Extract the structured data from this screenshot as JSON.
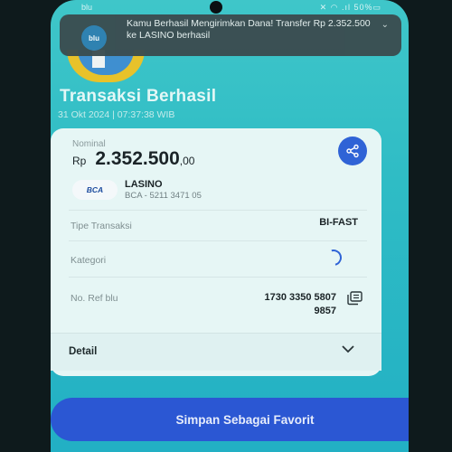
{
  "statusbar": {
    "carrier": "blu",
    "icons": "✕ ◠ .ıl 50%▭"
  },
  "notification": {
    "app_logo": "blu",
    "text": "Kamu Berhasil Mengirimkan Dana! Transfer Rp 2.352.500 ke LASINO berhasil"
  },
  "header": {
    "title": "Transaksi Berhasil",
    "datetime": "31 Okt 2024 | 07:37:38 WIB"
  },
  "transaction": {
    "nominal_label": "Nominal",
    "currency": "Rp",
    "amount_main": "2.352.500",
    "amount_decimal": ",00",
    "recipient": {
      "bank_logo": "BCA",
      "name": "LASINO",
      "account": "BCA - 5211 3471 05"
    },
    "rows": {
      "type_label": "Tipe Transaksi",
      "type_value": "BI-FAST",
      "category_label": "Kategori",
      "ref_label": "No. Ref blu",
      "ref_value": "1730 3350 5807 9857"
    },
    "detail_label": "Detail"
  },
  "actions": {
    "save_favorite": "Simpan Sebagai Favorit"
  },
  "colors": {
    "accent": "#2b57d3",
    "background": "#2fbcc5",
    "card": "#e6f6f5"
  },
  "icons": [
    "share-icon",
    "copy-icon",
    "chevron-down-icon",
    "loading-spinner-icon"
  ]
}
